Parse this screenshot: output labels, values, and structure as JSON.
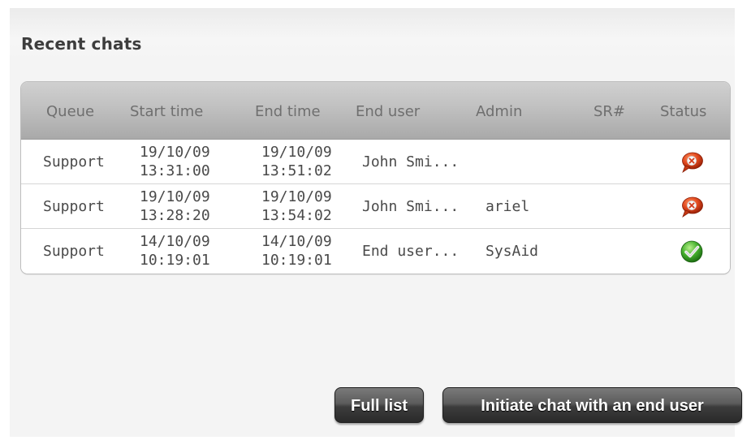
{
  "panel": {
    "title": "Recent chats"
  },
  "table": {
    "columns": [
      "Queue",
      "Start time",
      "End time",
      "End user",
      "Admin",
      "SR#",
      "Status"
    ],
    "rows": [
      {
        "queue": "Support",
        "start_date": "19/10/09",
        "start_time": "13:31:00",
        "end_date": "19/10/09",
        "end_time": "13:51:02",
        "end_user": "John Smi...",
        "admin": "",
        "sr": "",
        "status_icon": "chat-closed-icon",
        "status_color": "#d2401f"
      },
      {
        "queue": "Support",
        "start_date": "19/10/09",
        "start_time": "13:28:20",
        "end_date": "19/10/09",
        "end_time": "13:54:02",
        "end_user": "John Smi...",
        "admin": "ariel",
        "sr": "",
        "status_icon": "chat-closed-icon",
        "status_color": "#d2401f"
      },
      {
        "queue": "Support",
        "start_date": "14/10/09",
        "start_time": "10:19:01",
        "end_date": "14/10/09",
        "end_time": "10:19:01",
        "end_user": "End user...",
        "admin": "SysAid",
        "sr": "",
        "status_icon": "check-icon",
        "status_color": "#3fae2a"
      }
    ]
  },
  "buttons": {
    "full_list": "Full list",
    "initiate_chat": "Initiate chat with an end user"
  }
}
